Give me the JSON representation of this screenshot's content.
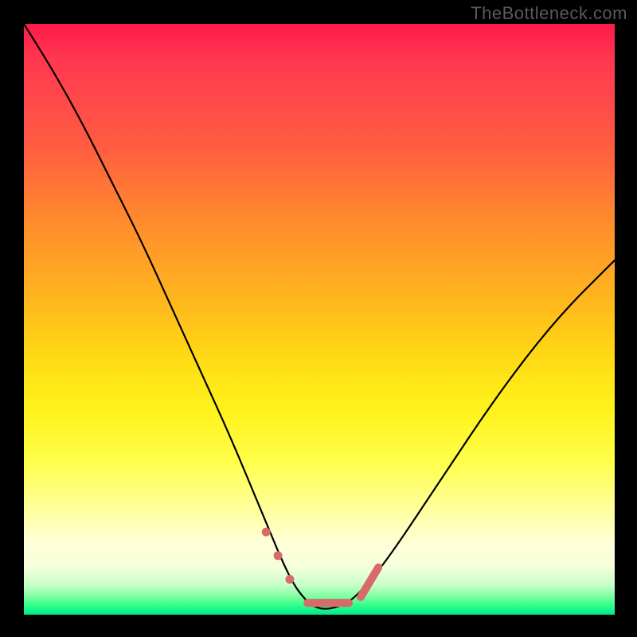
{
  "watermark": "TheBottleneck.com",
  "colors": {
    "frame": "#000000",
    "gradient_top": "#ff1a4a",
    "gradient_mid": "#ffff4a",
    "gradient_bottom": "#00e688",
    "curve": "#000000",
    "markers": "#d86a6a"
  },
  "chart_data": {
    "type": "line",
    "title": "",
    "xlabel": "",
    "ylabel": "",
    "x_range": [
      0,
      100
    ],
    "y_range": [
      0,
      100
    ],
    "ylim": [
      0,
      100
    ],
    "description": "Bottleneck severity curve. High (red/top) = severe bottleneck, low (green/bottom) = balanced. Valley near x≈45–55 marks optimal pairing.",
    "series": [
      {
        "name": "bottleneck-curve",
        "x": [
          0,
          5,
          10,
          15,
          20,
          25,
          30,
          35,
          40,
          45,
          48,
          50,
          52,
          55,
          58,
          62,
          70,
          80,
          90,
          100
        ],
        "y": [
          100,
          92,
          83,
          73,
          63,
          52,
          41,
          30,
          18,
          6,
          2,
          1,
          1,
          2,
          5,
          10,
          22,
          37,
          50,
          60
        ]
      }
    ],
    "annotations": {
      "optimal_zone_markers": {
        "note": "coral segments/dots highlighting the valley floor and lower flanks",
        "points_x": [
          41,
          43,
          45,
          48,
          50,
          52,
          55,
          57,
          58,
          60
        ],
        "points_y": [
          14,
          10,
          6,
          2,
          1,
          1,
          2,
          3,
          5,
          8
        ]
      }
    }
  }
}
